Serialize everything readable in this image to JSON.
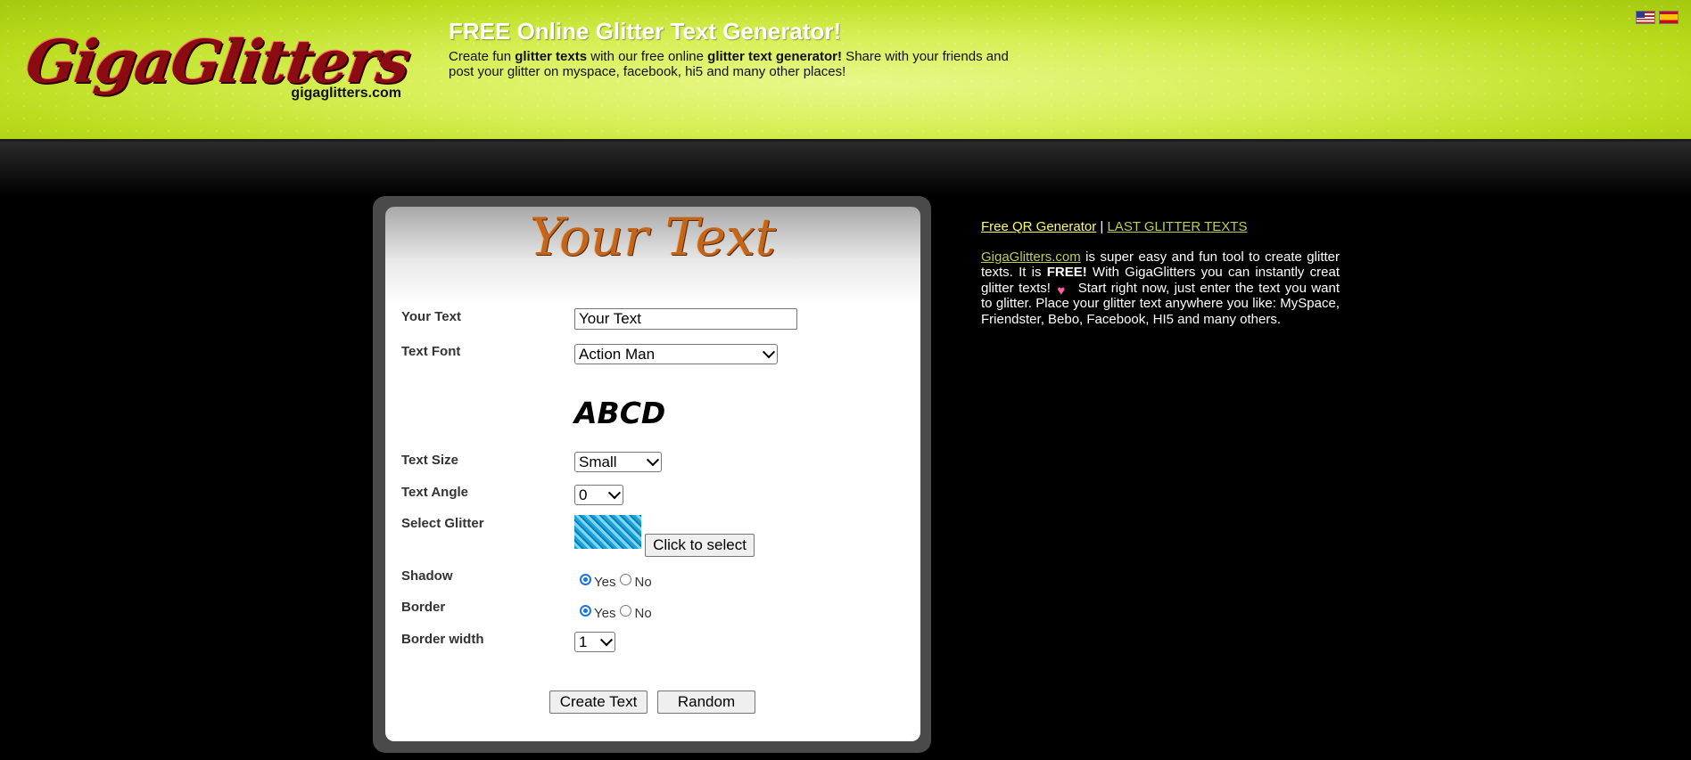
{
  "header": {
    "logo_text": "GigaGlitters",
    "logo_sub": "gigaglitters.com",
    "title": "FREE Online Glitter Text Generator!",
    "desc_1": "Create fun ",
    "desc_2": "glitter texts",
    "desc_3": " with our free online ",
    "desc_4": "glitter text generator!",
    "desc_5": " Share with your friends and post your glitter on myspace, facebook, hi5 and many other places!"
  },
  "flags": [
    "us-flag-icon",
    "spain-flag-icon"
  ],
  "form": {
    "title_preview": "Your Text",
    "your_text_label": "Your Text",
    "your_text_value": "Your Text",
    "font_label": "Text Font",
    "font_value": "Action Man",
    "font_preview": "ABCD",
    "size_label": "Text Size",
    "size_value": "Small",
    "angle_label": "Text Angle",
    "angle_value": "0",
    "glitter_label": "Select Glitter",
    "glitter_button": "Click to select",
    "shadow_label": "Shadow",
    "shadow_yes": "Yes",
    "shadow_no": "No",
    "border_label": "Border",
    "border_yes": "Yes",
    "border_no": "No",
    "border_width_label": "Border width",
    "border_width_value": "1",
    "create_button": "Create Text",
    "random_button": "Random"
  },
  "sidebar": {
    "qr_link": "Free QR Generator",
    "separator": "|",
    "last_link": "LAST GLITTER TEXTS",
    "site_link": "GigaGlitters.com",
    "desc_1": " is super easy and fun tool to create glitter texts. It is ",
    "desc_free": "FREE!",
    "desc_2": " With GigaGlitters you can instantly creat glitter texts! ",
    "desc_3": " Start right now, just enter the text you want to glitter. Place your glitter text anywhere you like: MySpace, Friendster, Bebo, Facebook, HI5 and many others."
  },
  "colors": {
    "header_green": "#d7ef55",
    "link_yellow": "#ffff66",
    "link_green": "#b8d24c",
    "title_orange": "#c2661e"
  }
}
